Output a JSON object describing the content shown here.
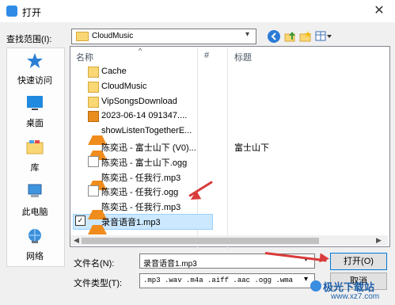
{
  "window": {
    "title": "打开",
    "close_glyph": "✕"
  },
  "toolbar": {
    "lookin_label": "查找范围(I):",
    "lookin_value": "CloudMusic",
    "icons": [
      "back-icon",
      "up-folder-icon",
      "new-folder-icon",
      "view-menu-icon"
    ]
  },
  "places": [
    {
      "label": "快速访问",
      "icon": "star-icon"
    },
    {
      "label": "桌面",
      "icon": "desktop-icon"
    },
    {
      "label": "库",
      "icon": "library-icon"
    },
    {
      "label": "此电脑",
      "icon": "computer-icon"
    },
    {
      "label": "网络",
      "icon": "network-icon"
    }
  ],
  "columns": {
    "name": "名称",
    "number": "#",
    "title": "标题"
  },
  "files": [
    {
      "name": "Cache",
      "type": "folder",
      "title": ""
    },
    {
      "name": "CloudMusic",
      "type": "folder",
      "title": ""
    },
    {
      "name": "VipSongsDownload",
      "type": "folder",
      "title": ""
    },
    {
      "name": "2023-06-14 091347....",
      "type": "xml",
      "title": ""
    },
    {
      "name": "showListenTogetherE...",
      "type": "vlc",
      "title": ""
    },
    {
      "name": "陈奕迅 - 富士山下 (V0)...",
      "type": "vlc",
      "title": "富士山下"
    },
    {
      "name": "陈奕迅 - 富士山下.ogg",
      "type": "doc",
      "title": ""
    },
    {
      "name": "陈奕迅 - 任我行.mp3",
      "type": "vlc",
      "title": ""
    },
    {
      "name": "陈奕迅 - 任我行.ogg",
      "type": "doc",
      "title": ""
    },
    {
      "name": "陈奕迅 - 任我行.mp3",
      "type": "vlc",
      "title": ""
    },
    {
      "name": "录音语音1.mp3",
      "type": "vlc",
      "title": "",
      "selected": true,
      "checked": true
    }
  ],
  "scrollbar": {
    "left_glyph": "◀",
    "right_glyph": "▶"
  },
  "bottom": {
    "filename_label": "文件名(N):",
    "filename_value": "录音语音1.mp3",
    "filetype_label": "文件类型(T):",
    "filetype_value": ".mp3 .wav .m4a .aiff .aac .ogg .wma ...",
    "open_button": "打开(O)",
    "cancel_button": "取消"
  },
  "watermark": {
    "title": "极光下载站",
    "url": "www.xz7.com"
  },
  "colors": {
    "annotation_arrow": "#d93a3a",
    "selection": "#cce8ff",
    "accent": "#0078d7"
  }
}
